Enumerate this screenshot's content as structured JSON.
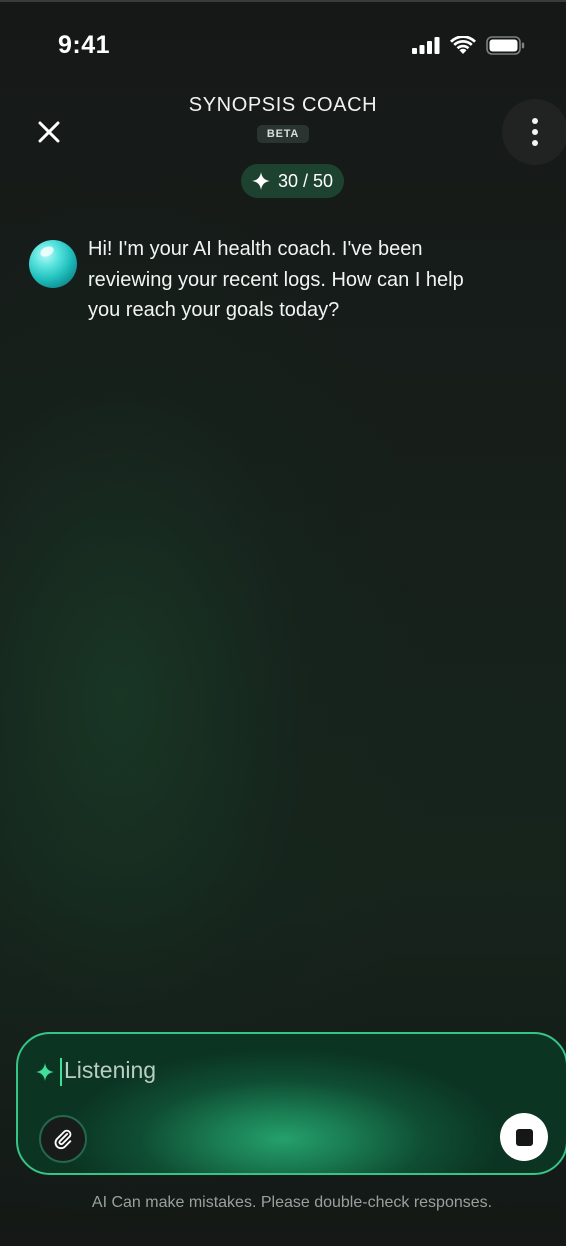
{
  "status_bar": {
    "time": "9:41",
    "icons": [
      "cellular-signal-icon",
      "wifi-icon",
      "battery-icon"
    ]
  },
  "header": {
    "close_icon": "close-icon",
    "title": "SYNOPSIS COACH",
    "badge": "BETA",
    "more_icon": "more-vertical-icon"
  },
  "credits": {
    "icon": "sparkle-icon",
    "text": "30 / 50"
  },
  "conversation": {
    "messages": [
      {
        "sender": "coach",
        "avatar_icon": "coach-avatar-orb",
        "text": "Hi! I'm your AI health coach. I've been reviewing your recent logs. How can I help you reach your goals today?"
      }
    ]
  },
  "composer": {
    "icon": "sparkle-icon",
    "placeholder": "Listening",
    "attach_icon": "paperclip-icon",
    "stop_icon": "stop-icon"
  },
  "disclaimer": "AI Can make mistakes. Please double-check responses.",
  "colors": {
    "background": "#151716",
    "accent": "#37c487",
    "credits_pill": "#1d4330",
    "avatar": "#2ed3cf"
  }
}
